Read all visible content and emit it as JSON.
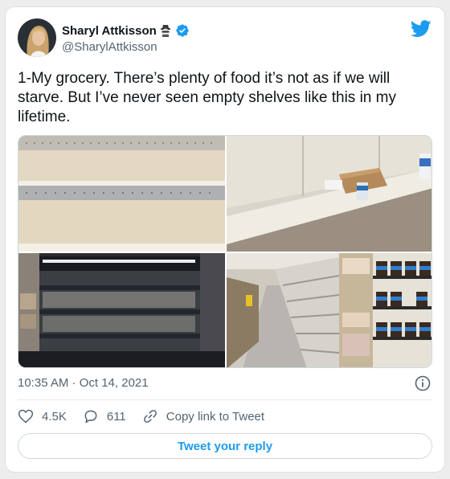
{
  "author": {
    "display_name": "Sharyl Attkisson",
    "handle": "@SharylAttkisson",
    "name_emoji_icon": "detective-icon",
    "verified_icon": "verified-badge-icon"
  },
  "tweet": {
    "text": "1-My grocery. There’s plenty of food it’s not as if we will starve. But I’ve never seen empty shelves like this in my lifetime.",
    "timestamp": "10:35 AM · Oct 14, 2021"
  },
  "media": {
    "photo_count": 4,
    "photos": [
      {
        "subject": "empty-store-shelves-closeup"
      },
      {
        "subject": "empty-shelves-with-box-and-carton"
      },
      {
        "subject": "empty-refrigerated-display-case"
      },
      {
        "subject": "grocery-aisle-with-empty-shelves-and-jars"
      }
    ]
  },
  "actions": {
    "like_count": "4.5K",
    "reply_count": "611",
    "copy_link_label": "Copy link to Tweet",
    "reply_button_label": "Tweet your reply"
  },
  "colors": {
    "brand_blue": "#1d9bf0",
    "text_primary": "#0f1419",
    "text_secondary": "#536471",
    "border": "#cfd9de"
  }
}
